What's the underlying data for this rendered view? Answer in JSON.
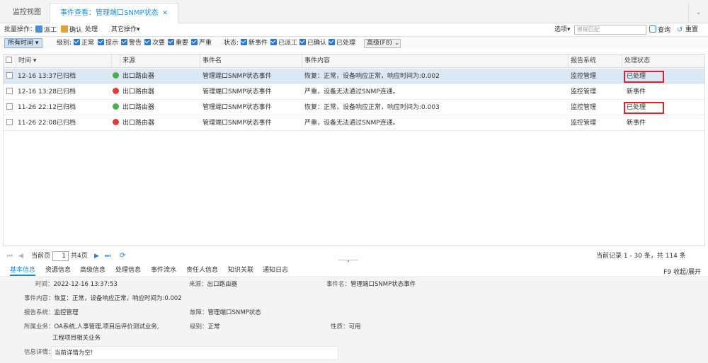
{
  "tabs": [
    {
      "label": "监控视图",
      "active": false
    },
    {
      "label": "事件查看：管理端口SNMP状态",
      "active": true
    }
  ],
  "toolbar": {
    "batch_label": "批量操作：",
    "dispatch": "派工",
    "confirm": "确认",
    "handle": "处理",
    "other_ops": "其它操作▾",
    "options": "选项▾",
    "search_placeholder": "模糊匹配",
    "search_btn": "查询",
    "reset_btn": "重置"
  },
  "filters": {
    "time_range": "所有时间",
    "level_label": "级别:",
    "levels": [
      "正常",
      "提示",
      "警告",
      "次要",
      "重要",
      "严重"
    ],
    "status_label": "状态:",
    "statuses": [
      "新事件",
      "已派工",
      "已确认",
      "已处理"
    ],
    "advanced": "高级(F8)"
  },
  "grid": {
    "columns": [
      "时间",
      "来源",
      "事件名",
      "事件内容",
      "报告系统",
      "处理状态"
    ],
    "rows": [
      {
        "time": "12-16 13:37",
        "archived": "已归档",
        "dot": "#4caf50",
        "source": "出口路由器",
        "name": "管理端口SNMP状态事件",
        "content": "恢复：正常，设备响应正常，响应时间为:0.002",
        "system": "监控管理",
        "status": "已处理",
        "selected": true,
        "highlight": true
      },
      {
        "time": "12-16 13:28",
        "archived": "已归档",
        "dot": "#e53935",
        "source": "出口路由器",
        "name": "管理端口SNMP状态事件",
        "content": "严重，设备无法通过SNMP连通。",
        "system": "监控管理",
        "status": "新事件",
        "selected": false,
        "highlight": false
      },
      {
        "time": "11-26 22:12",
        "archived": "已归档",
        "dot": "#4caf50",
        "source": "出口路由器",
        "name": "管理端口SNMP状态事件",
        "content": "恢复：正常，设备响应正常，响应时间为:0.003",
        "system": "监控管理",
        "status": "已处理",
        "selected": false,
        "highlight": true
      },
      {
        "time": "11-26 22:08",
        "archived": "已归档",
        "dot": "#e53935",
        "source": "出口路由器",
        "name": "管理端口SNMP状态事件",
        "content": "严重，设备无法通过SNMP连通。",
        "system": "监控管理",
        "status": "新事件",
        "selected": false,
        "highlight": false
      }
    ]
  },
  "pager": {
    "current_page_label": "当前页",
    "page": "1",
    "total_pages": "共4页",
    "records": "当前记录 1 - 30 条，共 114 条"
  },
  "detail_tabs": [
    "基本信息",
    "资源信息",
    "高级信息",
    "处理信息",
    "事件流水",
    "责任人信息",
    "知识关联",
    "通知日志"
  ],
  "collapse_hint": "F9 收起/展开",
  "detail": {
    "time_label": "时间：",
    "time": "2022-12-16 13:37:53",
    "source_label": "来源：",
    "source": "出口路由器",
    "event_label": "事件名：",
    "event": "管理端口SNMP状态事件",
    "content_label": "事件内容：",
    "content": "恢复：正常，设备响应正常，响应时间为:0.002",
    "system_label": "报告系统：",
    "system": "监控管理",
    "fault_label": "故障：",
    "fault": "管理端口SNMP状态",
    "business_label": "所属业务：",
    "business_line1": "OA系统,人事管理,项目后评价测试业务,",
    "business_line2": "工程项目相关业务",
    "level_label": "级别：",
    "level": "正常",
    "nature_label": "性质：",
    "nature": "可用",
    "info_label": "信息详情：",
    "info": "当前详情为空!"
  }
}
